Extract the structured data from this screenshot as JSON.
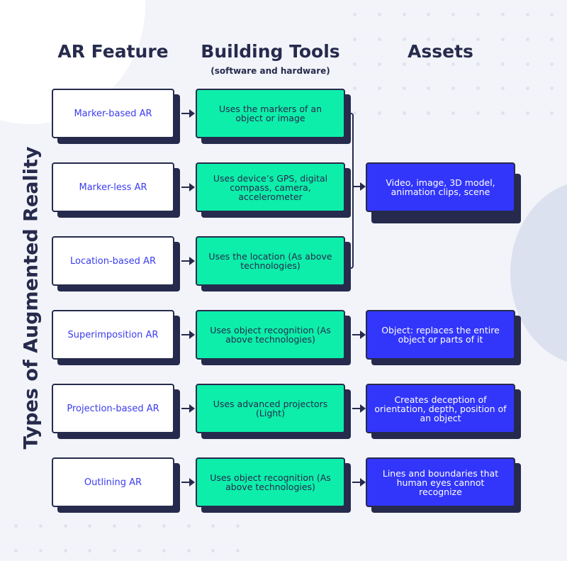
{
  "title": "Types of Augmented Reality",
  "columns": {
    "feature": "AR Feature",
    "tools": "Building Tools",
    "tools_sub": "(software and hardware)",
    "assets": "Assets"
  },
  "rows": [
    {
      "feature": "Marker-based AR",
      "tool": "Uses the markers of an object or image"
    },
    {
      "feature": "Marker-less AR",
      "tool": "Uses device’s GPS, digital compass, camera, accelerometer"
    },
    {
      "feature": "Location-based AR",
      "tool": "Uses the location (As above technologies)"
    },
    {
      "feature": "Superimposition AR",
      "tool": "Uses object recognition (As above technologies)",
      "asset": "Object: replaces the entire object or parts of it"
    },
    {
      "feature": "Projection-based AR",
      "tool": "Uses advanced projectors (Light)",
      "asset": "Creates deception of orientation, depth, position of an object"
    },
    {
      "feature": "Outlining AR",
      "tool": "Uses object recognition (As above technologies)",
      "asset": "Lines and boundaries that human eyes cannot recognize"
    }
  ],
  "shared_asset": "Video, image, 3D model, animation clips, scene",
  "colors": {
    "navy": "#262b4d",
    "green": "#0deeaa",
    "blue": "#3236fb",
    "feature_text": "#3b3cf0",
    "background": "#f3f4fa"
  }
}
